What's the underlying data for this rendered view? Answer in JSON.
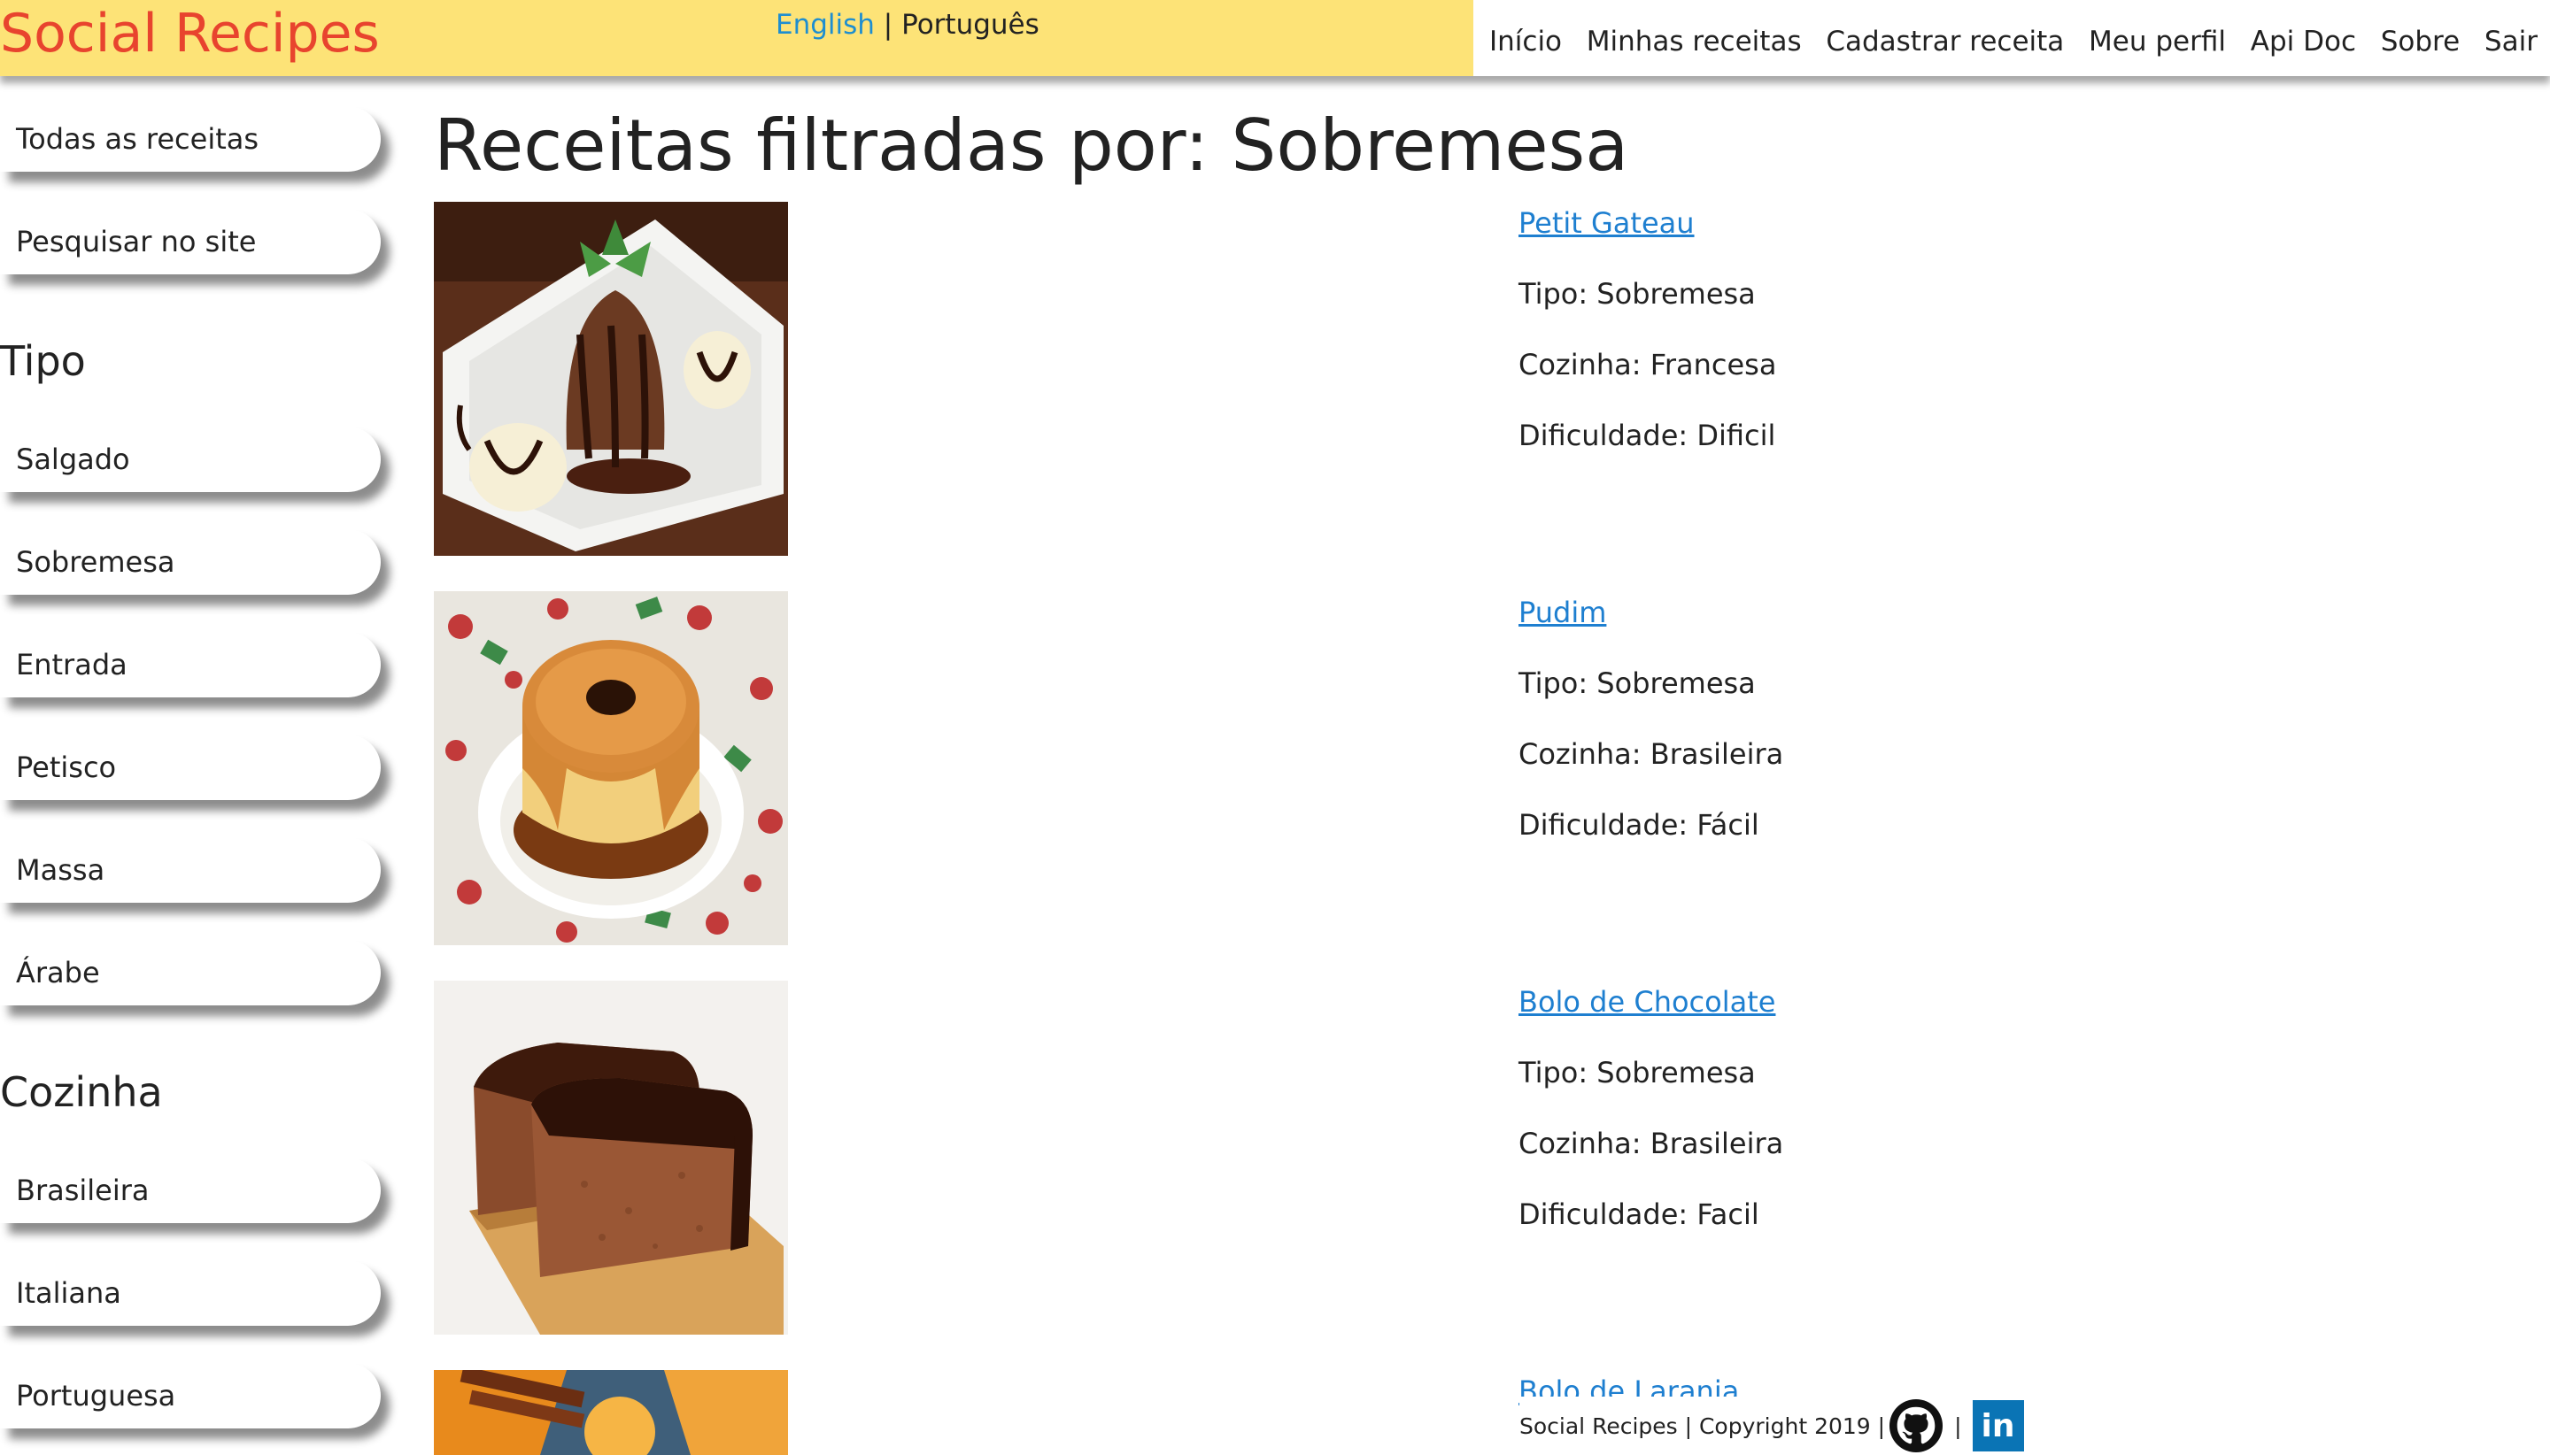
{
  "header": {
    "brand": "Social Recipes",
    "lang_en": "English",
    "lang_sep": "|",
    "lang_pt": "Português",
    "colors": {
      "brand_bg": "#fde377",
      "brand_text": "#e8442e",
      "link": "#1e7fd0"
    }
  },
  "nav": [
    {
      "label": "Início"
    },
    {
      "label": "Minhas receitas"
    },
    {
      "label": "Cadastrar receita"
    },
    {
      "label": "Meu perfil"
    },
    {
      "label": "Api Doc"
    },
    {
      "label": "Sobre"
    },
    {
      "label": "Sair"
    }
  ],
  "sidebar": {
    "all_recipes": "Todas as receitas",
    "search": "Pesquisar no site",
    "type_heading": "Tipo",
    "types": [
      {
        "label": "Salgado"
      },
      {
        "label": "Sobremesa"
      },
      {
        "label": "Entrada"
      },
      {
        "label": "Petisco"
      },
      {
        "label": "Massa"
      },
      {
        "label": "Árabe"
      }
    ],
    "cuisine_heading": "Cozinha",
    "cuisines": [
      {
        "label": "Brasileira"
      },
      {
        "label": "Italiana"
      },
      {
        "label": "Portuguesa"
      }
    ]
  },
  "main": {
    "title": "Receitas filtradas por: Sobremesa",
    "recipes": [
      {
        "name": "Petit Gateau",
        "tipo": "Tipo: Sobremesa",
        "cozinha": "Cozinha: Francesa",
        "dificuldade": "Dificuldade: Dificil",
        "image_icon": "petit-gateau-photo"
      },
      {
        "name": "Pudim",
        "tipo": "Tipo: Sobremesa",
        "cozinha": "Cozinha: Brasileira",
        "dificuldade": "Dificuldade: Fácil",
        "image_icon": "pudim-photo"
      },
      {
        "name": "Bolo de Chocolate",
        "tipo": "Tipo: Sobremesa",
        "cozinha": "Cozinha: Brasileira",
        "dificuldade": "Dificuldade: Facil",
        "image_icon": "chocolate-cake-photo"
      },
      {
        "name": "Bolo de Laranja",
        "image_icon": "orange-cake-photo"
      }
    ]
  },
  "footer": {
    "text": "Social Recipes | Copyright 2019 |",
    "pipe": "|",
    "github_icon": "github-icon",
    "linkedin_icon": "linkedin-icon",
    "linkedin_label": "in"
  }
}
